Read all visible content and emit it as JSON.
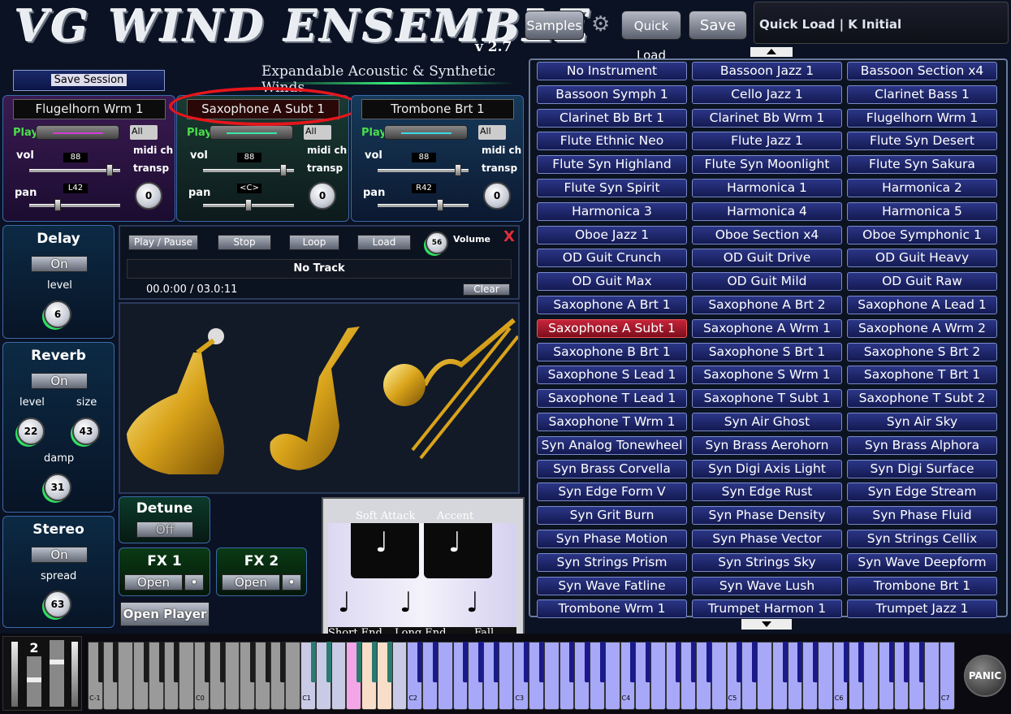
{
  "header": {
    "title": "VG WIND ENSEMBLE",
    "version": "v 2.7",
    "subtitle": "Expandable Acoustic & Synthetic Winds",
    "save_session": "Save Session"
  },
  "toolbar": {
    "samples": "Samples",
    "quick_load": "Quick Load",
    "save": "Save",
    "quick_load_display": "Quick Load | K Initial"
  },
  "slots": [
    {
      "name": "Flugelhorn Wrm 1",
      "play": "Play",
      "channel": "All",
      "vol_label": "vol",
      "vol": "88",
      "pan_label": "pan",
      "pan": "L42",
      "midi_label": "midi ch",
      "transp_label": "transp",
      "transp": "0"
    },
    {
      "name": "Saxophone A Subt 1",
      "play": "Play",
      "channel": "All",
      "vol_label": "vol",
      "vol": "88",
      "pan_label": "pan",
      "pan": "<C>",
      "midi_label": "midi ch",
      "transp_label": "transp",
      "transp": "0"
    },
    {
      "name": "Trombone Brt 1",
      "play": "Play",
      "channel": "All",
      "vol_label": "vol",
      "vol": "88",
      "pan_label": "pan",
      "pan": "R42",
      "midi_label": "midi ch",
      "transp_label": "transp",
      "transp": "0"
    }
  ],
  "delay": {
    "title": "Delay",
    "toggle": "On",
    "level_label": "level",
    "level": "6"
  },
  "reverb": {
    "title": "Reverb",
    "toggle": "On",
    "level_label": "level",
    "level": "22",
    "size_label": "size",
    "size": "43",
    "damp_label": "damp",
    "damp": "31"
  },
  "stereo": {
    "title": "Stereo",
    "toggle": "On",
    "spread_label": "spread",
    "spread": "63"
  },
  "detune": {
    "title": "Detune",
    "toggle": "Off"
  },
  "fx1": {
    "title": "FX 1",
    "open": "Open"
  },
  "fx2": {
    "title": "FX 2",
    "open": "Open"
  },
  "open_player": "Open Player",
  "player": {
    "play_pause": "Play / Pause",
    "stop": "Stop",
    "loop": "Loop",
    "load": "Load",
    "volume_label": "Volume",
    "volume": "56",
    "close": "X",
    "track": "No Track",
    "time": "00.0:00 / 03.0:11",
    "clear": "Clear"
  },
  "articulations": {
    "soft_attack": "Soft Attack",
    "accent": "Accent",
    "short_end": "Short End",
    "long_end": "Long End",
    "fall": "Fall"
  },
  "instruments": [
    "No Instrument",
    "Bassoon Jazz 1",
    "Bassoon Section x4",
    "Bassoon Symph 1",
    "Cello Jazz 1",
    "Clarinet Bass 1",
    "Clarinet Bb Brt 1",
    "Clarinet Bb Wrm 1",
    "Flugelhorn Wrm 1",
    "Flute Ethnic Neo",
    "Flute Jazz 1",
    "Flute Syn Desert",
    "Flute Syn Highland",
    "Flute Syn Moonlight",
    "Flute Syn Sakura",
    "Flute Syn Spirit",
    "Harmonica 1",
    "Harmonica 2",
    "Harmonica 3",
    "Harmonica 4",
    "Harmonica 5",
    "Oboe Jazz 1",
    "Oboe Section x4",
    "Oboe Symphonic 1",
    "OD Guit Crunch",
    "OD Guit Drive",
    "OD Guit Heavy",
    "OD Guit Max",
    "OD Guit Mild",
    "OD Guit Raw",
    "Saxophone A Brt 1",
    "Saxophone A Brt 2",
    "Saxophone A Lead 1",
    "Saxophone A Subt 1",
    "Saxophone A Wrm 1",
    "Saxophone A Wrm 2",
    "Saxophone B Brt 1",
    "Saxophone S Brt 1",
    "Saxophone S Brt 2",
    "Saxophone S Lead 1",
    "Saxophone S Wrm 1",
    "Saxophone T Brt 1",
    "Saxophone T Lead 1",
    "Saxophone T Subt 1",
    "Saxophone T Subt 2",
    "Saxophone T Wrm 1",
    "Syn Air Ghost",
    "Syn Air Sky",
    "Syn Analog Tonewheel",
    "Syn Brass Aerohorn",
    "Syn Brass Alphora",
    "Syn Brass Corvella",
    "Syn Digi Axis Light",
    "Syn Digi Surface",
    "Syn Edge Form V",
    "Syn Edge Rust",
    "Syn Edge Stream",
    "Syn Grit Burn",
    "Syn Phase Density",
    "Syn Phase Fluid",
    "Syn Phase Motion",
    "Syn Phase Vector",
    "Syn Strings Cellix",
    "Syn Strings Prism",
    "Syn Strings Sky",
    "Syn Wave Deepform",
    "Syn Wave Fatline",
    "Syn Wave Lush",
    "Trombone Brt 1",
    "Trombone Wrm 1",
    "Trumpet Harmon 1",
    "Trumpet Jazz 1"
  ],
  "selected_instrument": "Saxophone A Subt 1",
  "keyboard": {
    "octave": "2",
    "labels": [
      "C-1",
      "C0",
      "C1",
      "C2",
      "C3",
      "C4",
      "C5",
      "C6",
      "C7"
    ],
    "panic": "PANIC"
  },
  "colors": {
    "selected": "#c5243a",
    "instrument_button": "#2b3686",
    "play_green": "#49e04a",
    "key_range": "#a6a6ff"
  }
}
